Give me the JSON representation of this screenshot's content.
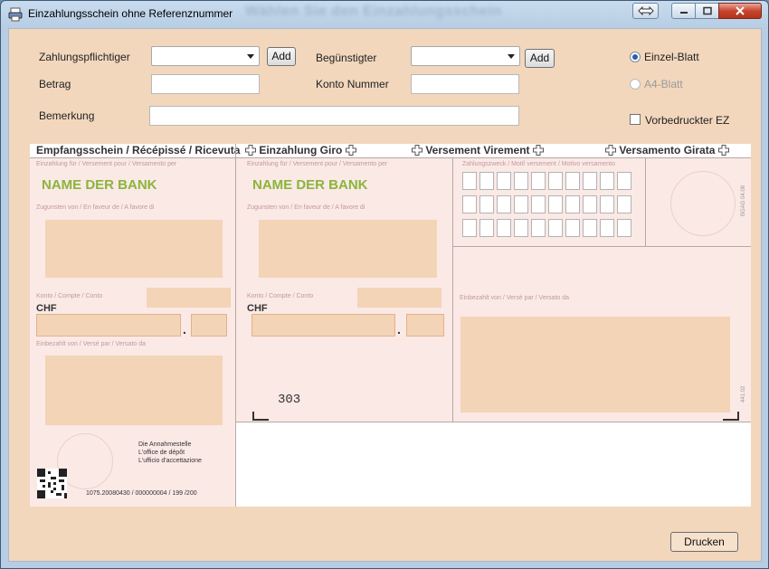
{
  "window": {
    "title": "Einzahlungsschein ohne Referenznummer",
    "blurred_heading": "Wählen Sie den Einzahlungsschein"
  },
  "form": {
    "payer_label": "Zahlungspflichtiger",
    "payer_value": "",
    "payer_add": "Add",
    "beneficiary_label": "Begünstigter",
    "beneficiary_value": "",
    "beneficiary_add": "Add",
    "amount_label": "Betrag",
    "amount_value": "",
    "account_label": "Konto Nummer",
    "account_value": "",
    "remark_label": "Bemerkung",
    "remark_value": "",
    "radio_single": "Einzel-Blatt",
    "radio_a4": "A4-Blatt",
    "radio_selected": "Einzel-Blatt",
    "preprinted_label": "Vorbedruckter EZ",
    "preprinted_checked": false
  },
  "slip": {
    "header_receipt": "Empfangsschein / Récépissé / Ricevuta",
    "header_giro": "Einzahlung Giro",
    "header_virement": "Versement Virement",
    "header_girata": "Versamento Girata",
    "deposit_for": "Einzahlung für / Versement pour / Versamento per",
    "in_favour": "Zugunsten von / En faveur de / A favore di",
    "account": "Konto / Compte / Conto",
    "paid_by": "Einbezahlt von / Versé par / Versato da",
    "purpose": "Zahlungszweck / Motif versement / Motivo versamento",
    "bank_name_left": "NAME DER BANK",
    "bank_name_mid": "NAME DER BANK",
    "currency_left": "CHF",
    "currency_mid": "CHF",
    "code_303": "303",
    "office_line1": "Die Annahmestelle",
    "office_line2": "L'office de dépôt",
    "office_line3": "L'ufficio d'accettazione",
    "footer_code": "1075.20080430 / 000000004 / 199 /200",
    "side_code_top": "BGAG 04.08",
    "side_code_bottom": "441.02"
  },
  "footer": {
    "print_button": "Drucken"
  },
  "colors": {
    "client_bg": "#f2d7bd",
    "field_fill": "#f3d4b6",
    "bank_green": "#8ab53a",
    "close_red": "#c8462f"
  }
}
